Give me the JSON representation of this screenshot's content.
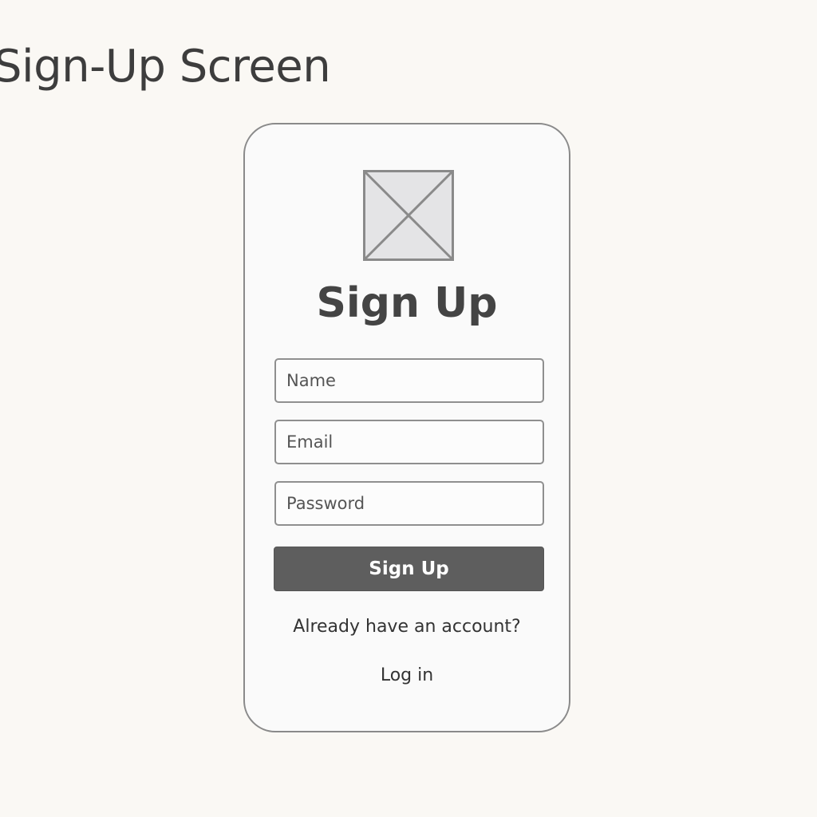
{
  "page": {
    "heading": "Sign-Up Screen"
  },
  "form": {
    "logo_icon": "image-placeholder-icon",
    "title": "Sign Up",
    "name_placeholder": "Name",
    "email_placeholder": "Email",
    "password_placeholder": "Password",
    "submit_label": "Sign Up",
    "login_prompt": "Already have an account?",
    "login_link": "Log in"
  },
  "colors": {
    "background": "#faf8f4",
    "frame_border": "#8a8a8a",
    "button_fill": "#5e5e5e",
    "text": "#3c3c3c"
  }
}
